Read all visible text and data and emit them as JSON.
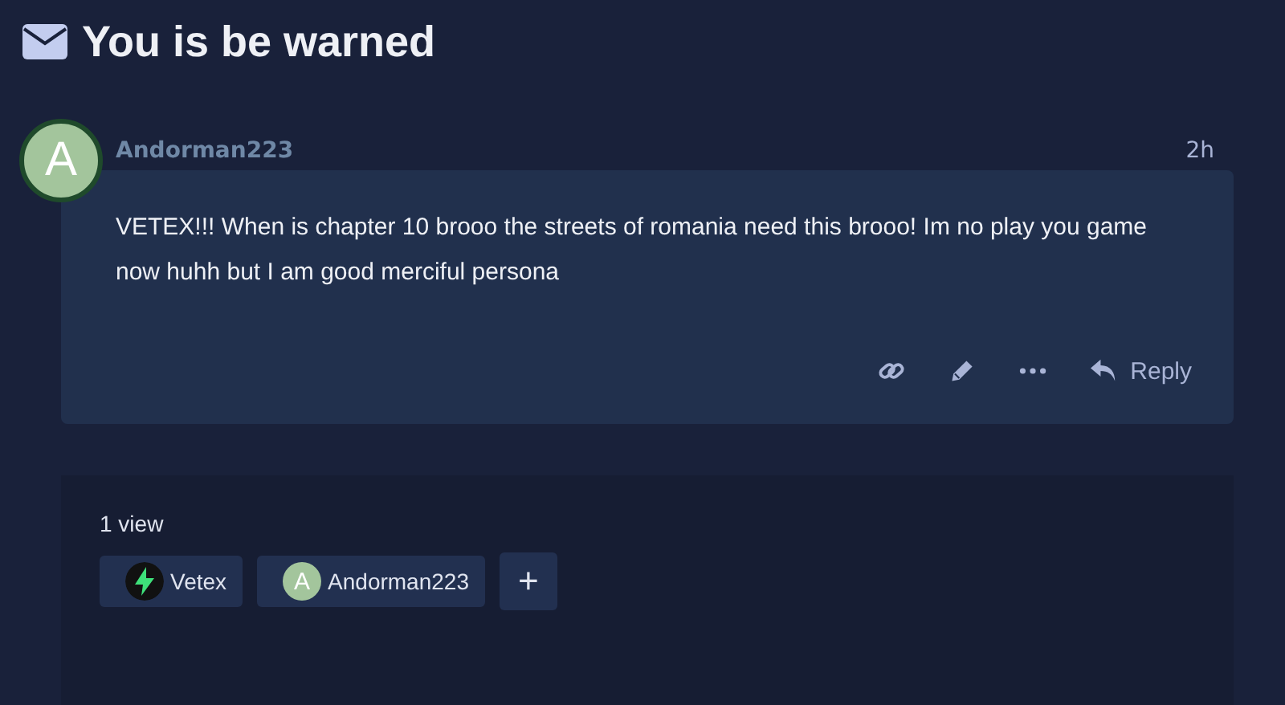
{
  "title": "You is be warned",
  "post": {
    "avatar_letter": "A",
    "author": "Andorman223",
    "time": "2h",
    "body": "VETEX!!! When is chapter 10 brooo the streets of romania need this brooo! Im no play you game now huhh but I am good merciful persona",
    "reply_label": "Reply"
  },
  "footer": {
    "views": "1 view",
    "participants": [
      {
        "kind": "icon",
        "name": "Vetex"
      },
      {
        "kind": "letter",
        "letter": "A",
        "name": "Andorman223"
      }
    ],
    "add_label": "+"
  }
}
